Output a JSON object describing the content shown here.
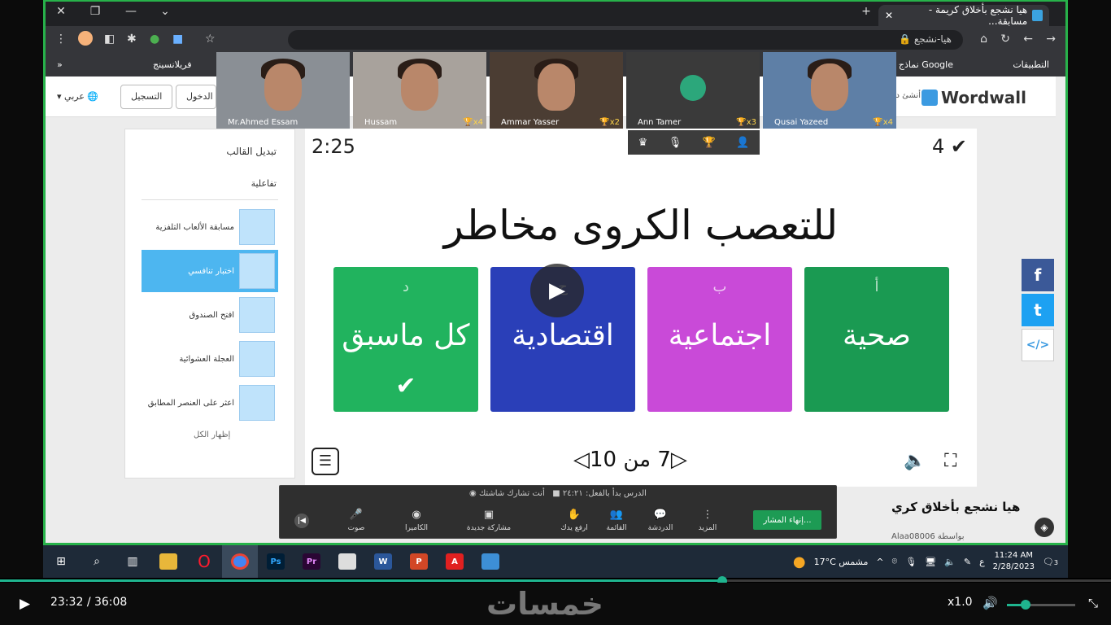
{
  "browser": {
    "tab_title": "هيا نشجع بأخلاق كريمة - مسابقة...",
    "url": "هيا-نشجع",
    "bookmarks": [
      "التطبيقات",
      "نماذج Google",
      "فريلانسينج"
    ],
    "bookmarks_more": "»"
  },
  "wordwall": {
    "logo": "Wordwall",
    "header_partial": "أنشئ دروس",
    "login": "تسجيل الدخول",
    "signup": "التسجيل",
    "language": "عربي"
  },
  "sidebar": {
    "title": "تبديل القالب",
    "section": "تفاعلية",
    "items": [
      {
        "label": "مسابقة الألعاب التلفزية",
        "active": false
      },
      {
        "label": "اختبار تنافسي",
        "active": true
      },
      {
        "label": "افتح الصندوق",
        "active": false
      },
      {
        "label": "العجلة العشوائية",
        "active": false
      },
      {
        "label": "اعثر على العنصر المطابق",
        "active": false
      }
    ],
    "show_all": "إظهار الكل"
  },
  "game": {
    "timer": "2:25",
    "score": "4",
    "question": "للتعصب الكروى مخاطر",
    "answers": [
      {
        "letter": "أ",
        "text": "صحية",
        "color": "#1a9a52"
      },
      {
        "letter": "ب",
        "text": "اجتماعية",
        "color": "#c94ad8"
      },
      {
        "letter": "ج",
        "text": "اقتصادية",
        "color": "#2a3fb8"
      },
      {
        "letter": "د",
        "text": "كل ماسبق",
        "color": "#21b35e",
        "correct": true
      }
    ],
    "pager": "7 من 10"
  },
  "participants": [
    {
      "name": "Mr.Ahmed Essam",
      "badge": ""
    },
    {
      "name": "Hussam",
      "badge": "x4"
    },
    {
      "name": "Ammar Yasser",
      "badge": "x2"
    },
    {
      "name": "Ann Tamer",
      "badge": "x3"
    },
    {
      "name": "Qusai Yazeed",
      "badge": "x4"
    }
  ],
  "meeting": {
    "status_started": "الدرس بدأ بالفعل: ٢٤:٢١",
    "status_sharing": "أنت تشارك شاشتك",
    "buttons": [
      "صوت",
      "الكاميرا",
      "مشاركة جديدة",
      "ارفع يدك",
      "القائمة",
      "الدردشة",
      "المزيد"
    ],
    "end": "إنهاء المشار..."
  },
  "page_below": {
    "title": "هيا نشجع بأخلاق كري",
    "author_prefix": "بواسطة",
    "author": "Alaa08006"
  },
  "taskbar": {
    "weather": "17°C مشمس",
    "lang": "ع",
    "time": "11:24 AM",
    "date": "2/28/2023",
    "notif": "3"
  },
  "player": {
    "current": "23:32",
    "separator": "/",
    "total": "36:08",
    "speed": "x1.0",
    "brand": "خمسات",
    "progress": 0.65,
    "volume": 0.27
  }
}
